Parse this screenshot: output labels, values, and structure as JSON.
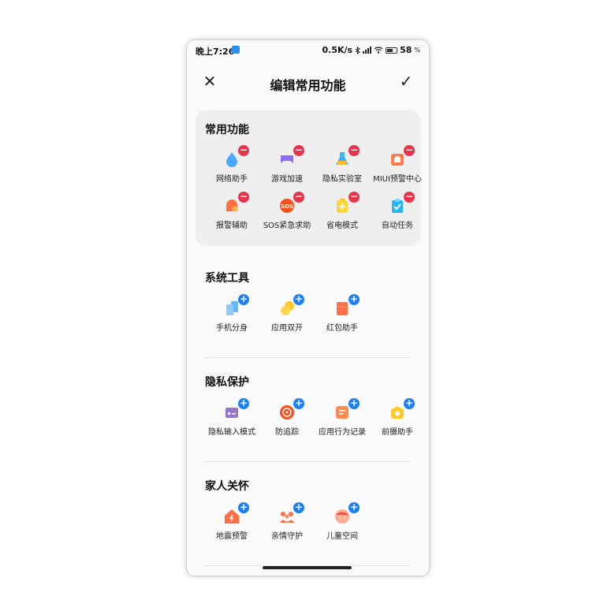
{
  "status_bar": {
    "time": "晚上7:26",
    "speed": "0.5K/s",
    "battery": "58",
    "battery_unit": "%"
  },
  "header": {
    "close_glyph": "✕",
    "title": "编辑常用功能",
    "confirm_glyph": "✓"
  },
  "common": {
    "title": "常用功能",
    "items": [
      {
        "label": "网络助手",
        "icon": "water-drop-icon"
      },
      {
        "label": "游戏加速",
        "icon": "gamepad-icon"
      },
      {
        "label": "隐私实验室",
        "icon": "flask-icon"
      },
      {
        "label": "MIUI预警中心",
        "icon": "alarm-icon"
      },
      {
        "label": "报警辅助",
        "icon": "siren-icon"
      },
      {
        "label": "SOS紧急求助",
        "icon": "sos-icon"
      },
      {
        "label": "省电模式",
        "icon": "battery-saver-icon"
      },
      {
        "label": "自动任务",
        "icon": "task-icon"
      }
    ]
  },
  "system_tools": {
    "title": "系统工具",
    "items": [
      {
        "label": "手机分身",
        "icon": "phone-clone-icon"
      },
      {
        "label": "应用双开",
        "icon": "dual-apps-icon"
      },
      {
        "label": "红包助手",
        "icon": "red-packet-icon"
      }
    ]
  },
  "privacy": {
    "title": "隐私保护",
    "items": [
      {
        "label": "隐私输入模式",
        "icon": "keyboard-icon"
      },
      {
        "label": "防追踪",
        "icon": "target-icon"
      },
      {
        "label": "应用行为记录",
        "icon": "record-icon"
      },
      {
        "label": "前摄助手",
        "icon": "camera-icon"
      }
    ]
  },
  "family": {
    "title": "家人关怀",
    "items": [
      {
        "label": "地震预警",
        "icon": "earthquake-icon"
      },
      {
        "label": "亲情守护",
        "icon": "family-icon"
      },
      {
        "label": "儿童空间",
        "icon": "kid-icon"
      }
    ]
  },
  "colors": {
    "remove_badge": "#e8344a",
    "add_badge": "#1e7ff5"
  }
}
